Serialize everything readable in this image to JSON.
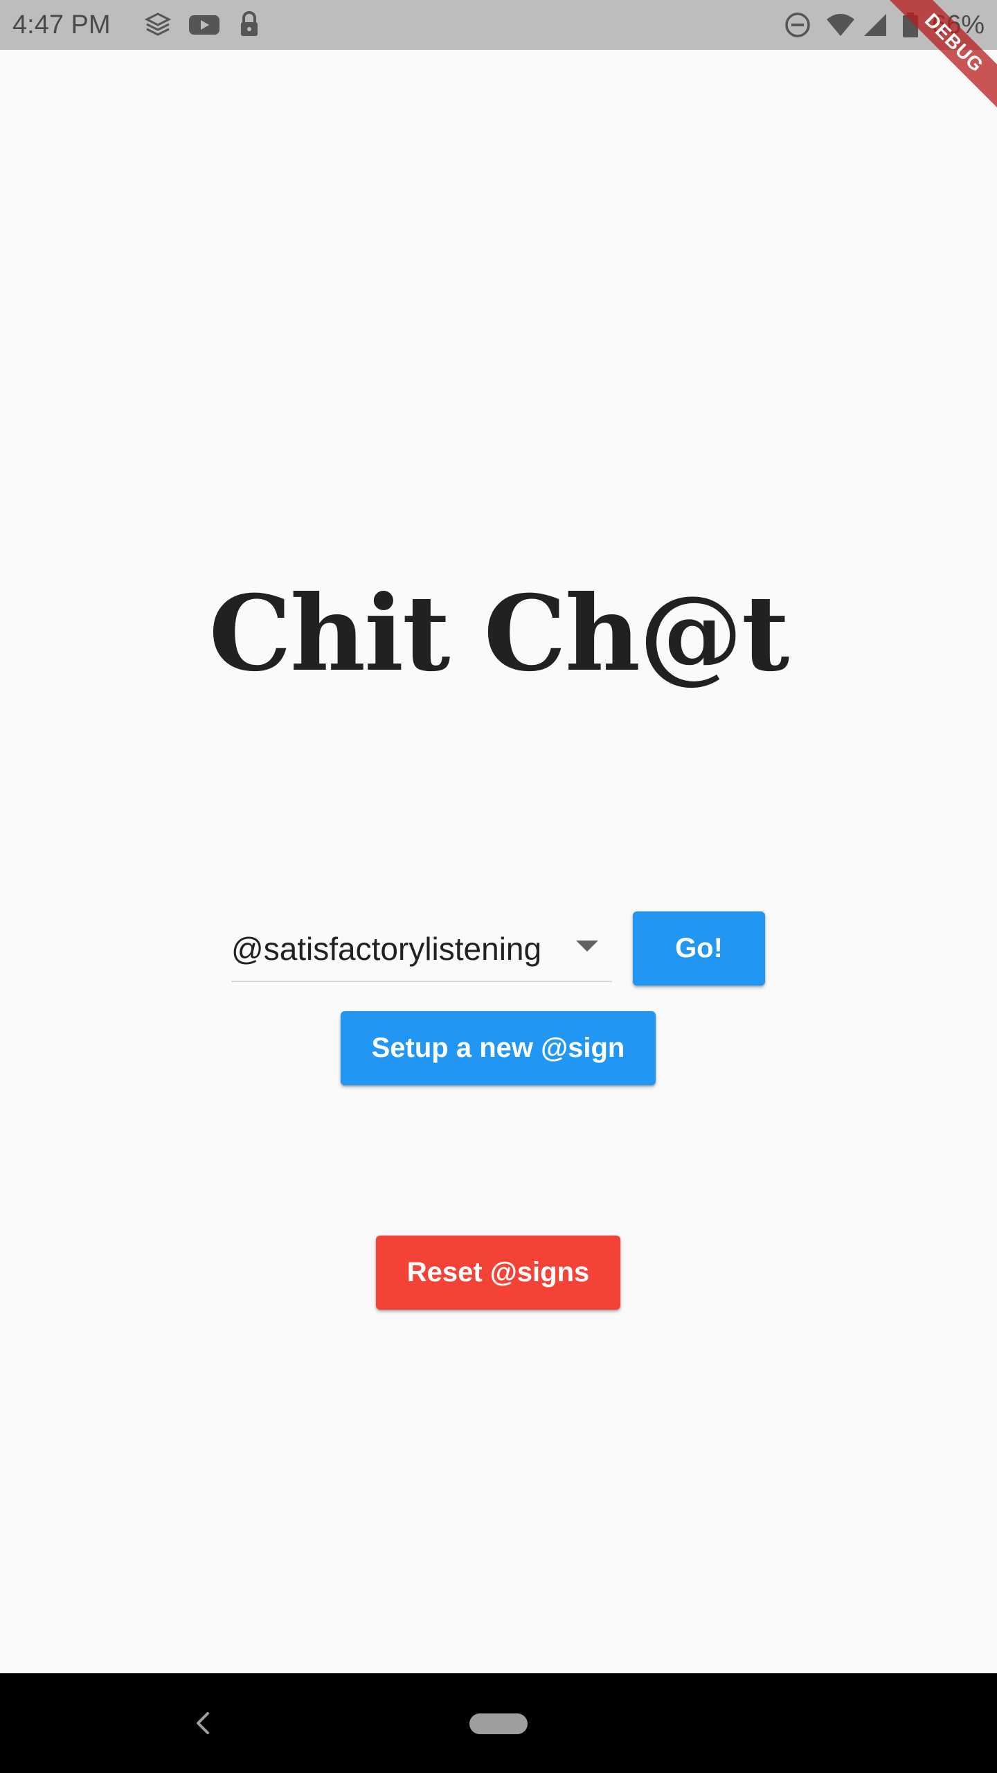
{
  "status_bar": {
    "time": "4:47 PM",
    "battery_percent": "66%",
    "left_icons": [
      "stack-icon",
      "youtube-icon",
      "lock-icon"
    ],
    "right_icons": [
      "do-not-disturb-icon",
      "wifi-icon",
      "cell-signal-icon",
      "battery-icon"
    ]
  },
  "debug_banner": {
    "label": "DEBUG",
    "color": "#b71c1c"
  },
  "app": {
    "title": "Chit Ch@t"
  },
  "login": {
    "selected_atsign": "@satisfactorylistening",
    "go_label": "Go!",
    "setup_label": "Setup a new @sign",
    "reset_label": "Reset @signs"
  },
  "colors": {
    "primary": "#2196f3",
    "danger": "#f44336",
    "background": "#fafafa",
    "status_bar": "#bdbdbd",
    "nav_bar": "#000000"
  },
  "nav_bar": {
    "icons": [
      "back-icon",
      "home-pill-icon"
    ]
  }
}
